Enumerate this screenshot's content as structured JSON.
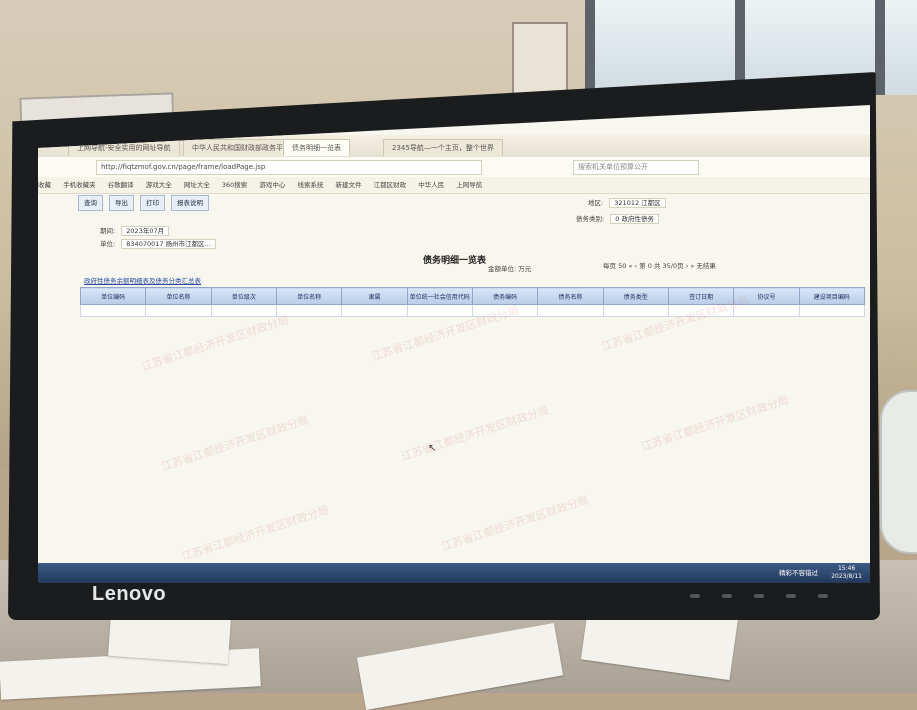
{
  "browser": {
    "tabs": [
      "上网导航-安全实用的网址导航",
      "中华人民共和国财政部政务平台",
      "债务明细一览表",
      "2345导航—一个主页，整个世界"
    ],
    "address": "http://fiqtzmof.gov.cn/page/frame/loadPage.jsp",
    "search_placeholder": "搜索机关单位预算公开"
  },
  "bookmarks": [
    "收藏",
    "手机收藏夹",
    "谷歌翻译",
    "游戏大全",
    "网址大全",
    "360搜索",
    "游戏中心",
    "线索系统",
    "新建文件",
    "江都区财政",
    "中华人民",
    "上网导航"
  ],
  "toolbar": {
    "query": "查询",
    "export": "导出",
    "print": "打印",
    "report": "报表说明"
  },
  "form": {
    "region_label": "地区:",
    "region_value": "321012 江都区",
    "debt_category_label": "债务类别:",
    "debt_category_value": "0 政府性债务",
    "period_label": "期间:",
    "period_value": "2023年07月",
    "unit_label": "单位:",
    "unit_value": "834070017 扬州市江都区..."
  },
  "report": {
    "title": "债务明细一览表",
    "money_unit_label": "金额单位:",
    "money_unit_value": "万元",
    "page_size_label": "每页",
    "page_size": "50",
    "page_label": "第",
    "page_value": "0",
    "total_pages": "共 35/0页",
    "no_result": "无结果",
    "link_text": "政府性债务余额明细表及债务分类汇总表"
  },
  "table_headers": [
    "单位编码",
    "单位名称",
    "单位级次",
    "单位名称",
    "隶属",
    "单位统一社会信用代码",
    "债务编码",
    "债务名称",
    "债务类型",
    "签订日期",
    "协议号",
    "建设项目编码"
  ],
  "watermark": "江苏省江都经济开发区财政分局",
  "monitor_brand": "Lenovo",
  "taskbar": {
    "tray_text": "精彩不容错过",
    "time": "15:46",
    "date": "2023/8/11"
  }
}
